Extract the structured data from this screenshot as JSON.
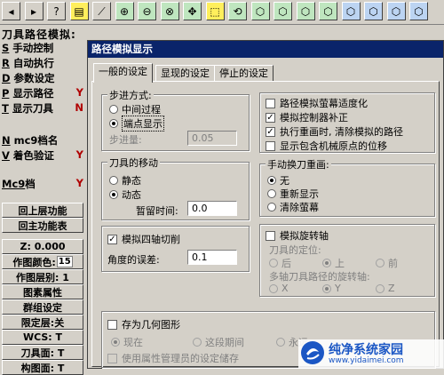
{
  "toolbar": {
    "buttons": [
      {
        "name": "back-arrow-icon",
        "glyph": "◂"
      },
      {
        "name": "forward-arrow-icon",
        "glyph": "▸"
      },
      {
        "name": "help-icon",
        "glyph": "?"
      },
      {
        "name": "calculator-icon",
        "glyph": "▤"
      },
      {
        "name": "measure-icon",
        "glyph": "⟋"
      },
      {
        "name": "zoom-in-icon",
        "glyph": "⊕"
      },
      {
        "name": "zoom-out-icon",
        "glyph": "⊖"
      },
      {
        "name": "zoom-fit-icon",
        "glyph": "⊗"
      },
      {
        "name": "pan-icon",
        "glyph": "✥"
      },
      {
        "name": "zoom-window-icon",
        "glyph": "⬚"
      },
      {
        "name": "rotate-view-icon",
        "glyph": "⟲"
      },
      {
        "name": "cube-view-1-icon",
        "glyph": "⬡"
      },
      {
        "name": "cube-view-2-icon",
        "glyph": "⬡"
      },
      {
        "name": "cube-view-3-icon",
        "glyph": "⬡"
      },
      {
        "name": "cube-view-4-icon",
        "glyph": "⬡"
      },
      {
        "name": "cube-view-5-icon",
        "glyph": "⬡"
      },
      {
        "name": "cube-view-6-icon",
        "glyph": "⬡"
      },
      {
        "name": "cube-view-7-icon",
        "glyph": "⬡"
      },
      {
        "name": "cube-view-8-icon",
        "glyph": "⬡"
      }
    ]
  },
  "left_panel": {
    "title": "刀具路径模拟:",
    "items": [
      {
        "key": "S",
        "label": "手动控制",
        "flag": ""
      },
      {
        "key": "R",
        "label": "自动执行",
        "flag": ""
      },
      {
        "key": "D",
        "label": "参数设定",
        "flag": ""
      },
      {
        "key": "P",
        "label": "显示路径",
        "flag": "Y"
      },
      {
        "key": "T",
        "label": "显示刀具",
        "flag": "N"
      },
      {
        "key": "N",
        "label": "mc9档名",
        "flag": ""
      },
      {
        "key": "V",
        "label": "着色验证",
        "flag": "Y"
      },
      {
        "key": "Mc9",
        "label": "档",
        "flag": "Y"
      }
    ],
    "buttons": [
      {
        "label": "回上层功能"
      },
      {
        "label": "回主功能表"
      }
    ],
    "status": [
      {
        "label": "Z:  0.000",
        "value": ""
      },
      {
        "label": "作图颜色:",
        "value": "15"
      },
      {
        "label": "作图层别: 1",
        "value": ""
      },
      {
        "label": "图素属性",
        "value": ""
      },
      {
        "label": "群组设定",
        "value": ""
      },
      {
        "label": "限定层:关",
        "value": ""
      },
      {
        "label": "WCS:  T",
        "value": ""
      },
      {
        "label": "刀具面: T",
        "value": ""
      },
      {
        "label": "构图面: T",
        "value": ""
      }
    ]
  },
  "dialog": {
    "title": "路径模拟显示",
    "tabs": [
      "一般的设定",
      "显现的设定",
      "停止的设定"
    ],
    "step_mode": {
      "label": "步进方式:",
      "options": [
        "中间过程",
        "端点显示"
      ],
      "selected": "端点显示",
      "step_label": "步进量:",
      "step_value": "0.05"
    },
    "tool_motion": {
      "label": "刀具的移动",
      "options": [
        "静态",
        "动态"
      ],
      "selected": "动态",
      "dwell_label": "暂留时间:",
      "dwell_value": "0.0"
    },
    "four_axis": {
      "checkbox_label": "模拟四轴切削",
      "checked": true,
      "angle_label": "角度的误差:",
      "angle_value": "0.1"
    },
    "right_options": [
      {
        "label": "路径模拟萤幕适度化",
        "checked": false
      },
      {
        "label": "模拟控制器补正",
        "checked": true
      },
      {
        "label": "执行重画时, 清除模拟的路径",
        "checked": true
      },
      {
        "label": "显示包含机械原点的位移",
        "checked": false
      }
    ],
    "manual_redraw": {
      "label": "手动换刀重画:",
      "options": [
        "无",
        "重新显示",
        "清除萤幕"
      ],
      "selected": "无"
    },
    "rotary": {
      "checkbox_label": "模拟旋转轴",
      "checked": false,
      "tool_position_label": "刀具的定位:",
      "tool_position_options": [
        "后",
        "上",
        "前"
      ],
      "tool_position_selected": "上",
      "multiaxis_label": "多轴刀具路径的旋转轴:",
      "multiaxis_options": [
        "X",
        "Y",
        "Z"
      ],
      "multiaxis_selected": "Y"
    },
    "save_geometry": {
      "checkbox_label": "存为几何图形",
      "checked": false,
      "options": [
        "现在",
        "这段期间",
        "永远"
      ],
      "selected": "现在",
      "attribute_label": "使用属性管理员的设定储存"
    }
  },
  "watermark": {
    "text": "纯净系统家园",
    "url": "www.yidaimei.com"
  }
}
